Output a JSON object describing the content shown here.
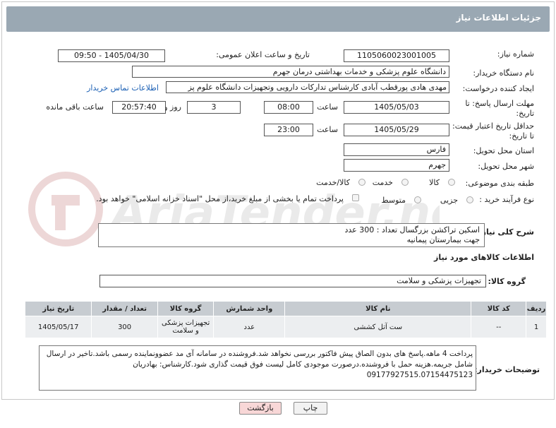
{
  "page": {
    "title": "جزئیات اطلاعات نیاز"
  },
  "fields": {
    "need_number": {
      "label": "شماره نیاز:",
      "value": "1105060023001005"
    },
    "announce_datetime": {
      "label": "تاریخ و ساعت اعلان عمومی:",
      "value": "1405/04/30 - 09:50"
    },
    "buyer_org": {
      "label": "نام دستگاه خریدار:",
      "value": "دانشگاه علوم پزشکی و خدمات بهداشتی  درمان جهرم"
    },
    "requester": {
      "label": "ایجاد کننده درخواست:",
      "value": "مهدی هادی پورقطب آبادی کارشناس تدارکات دارویی وتجهیزات دانشگاه علوم پز",
      "contact_link": "اطلاعات تماس خریدار"
    },
    "reply_deadline": {
      "label_line1": "مهلت ارسال پاسخ: تا",
      "label_line2": "تاریخ:",
      "date": "1405/05/03",
      "time_label": "ساعت",
      "time": "08:00",
      "days": "3",
      "days_label": "روز و",
      "remaining": "20:57:40",
      "remaining_label": "ساعت باقی مانده"
    },
    "price_validity": {
      "label_line1": "حداقل تاریخ اعتبار قیمت:",
      "label_line2": "تا تاریخ:",
      "date": "1405/05/29",
      "time_label": "ساعت",
      "time": "23:00"
    },
    "province": {
      "label": "استان محل تحویل:",
      "value": "فارس"
    },
    "city": {
      "label": "شهر محل تحویل:",
      "value": "جهرم"
    },
    "category": {
      "label": "طبقه بندی موضوعی:",
      "options": [
        "کالا",
        "خدمت",
        "کالا/خدمت"
      ]
    },
    "process": {
      "label": "نوع فرآیند خرید :",
      "options": [
        "جزیی",
        "متوسط"
      ],
      "payment_note": "پرداخت تمام یا بخشی از مبلغ خرید،از محل \"اسناد خزانه اسلامی\" خواهد بود."
    }
  },
  "general_description": {
    "label": "شرح کلی نیاز:",
    "line1": "اسکین تراکشن بزرگسال      تعداد : 300  عدد",
    "line2": "جهت بیمارستان پیمانیه"
  },
  "goods_info": {
    "title": "اطلاعات کالاهای مورد نیاز",
    "group_label": "گروه کالا:",
    "group_value": "تجهیزات پزشکی و سلامت"
  },
  "table": {
    "headers": [
      "ردیف",
      "کد کالا",
      "نام کالا",
      "واحد شمارش",
      "گروه کالا",
      "تعداد / مقدار",
      "تاریخ نیاز"
    ],
    "rows": [
      [
        "1",
        "--",
        "ست آتل کششی",
        "عدد",
        "تجهیزات پزشکی و سلامت",
        "300",
        "1405/05/17"
      ]
    ]
  },
  "buyer_notes": {
    "label": "توضیحات خریدار:",
    "text": "پرداخت 4 ماهه.پاسخ های بدون الصاق پیش فاکتور بررسی نخواهد شد.فروشنده در سامانه آی مد عضوونماینده رسمی باشد.تاخیر در ارسال شامل جریمه.هزینه حمل با فروشنده.درصورت موجودی کامل لیست فوق قیمت گذاری شود.کارشناس: بهادریان 09177927515.07154475123"
  },
  "buttons": {
    "print": "چاپ",
    "back": "بازگشت"
  },
  "watermark": "AriaTender.net",
  "colors": {
    "header": "#9aa8b3",
    "link": "#1a5fb4",
    "back_button": "#f8d7d7"
  }
}
